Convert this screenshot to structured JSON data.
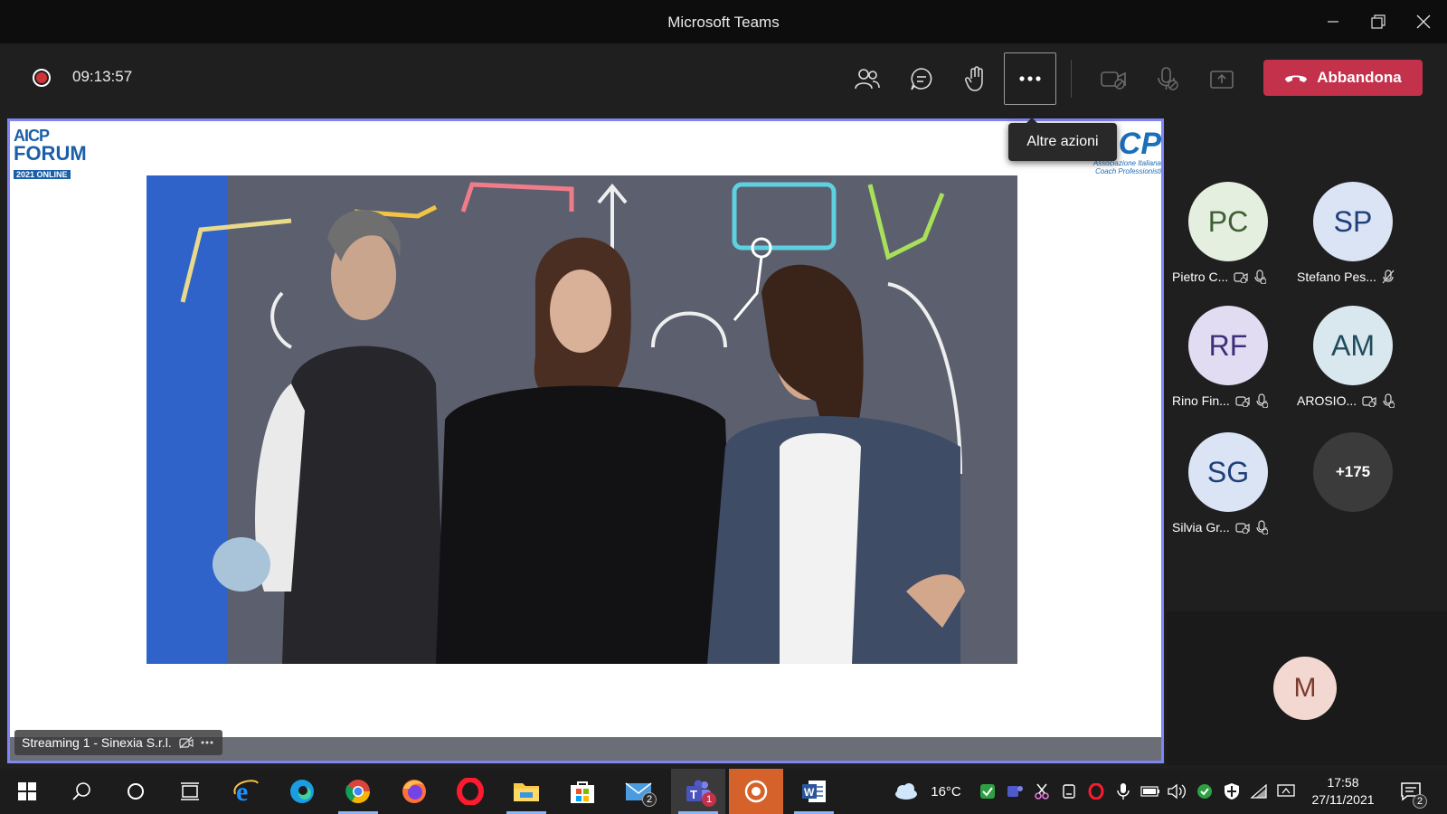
{
  "window": {
    "title": "Microsoft Teams"
  },
  "meeting": {
    "timer": "09:13:57",
    "leave_label": "Abbandona",
    "tooltip": "Altre azioni",
    "shared_label": "Streaming 1 - Sinexia S.r.l.",
    "accent": "#7f85f5",
    "leave_color": "#c4314b"
  },
  "stage": {
    "logo_left": {
      "line1": "AICP",
      "line2": "FORUM",
      "line3": "2021 ONLINE"
    },
    "logo_right": {
      "mark": "CP",
      "sub1": "Associazione Italiana",
      "sub2": "Coach Professionisti"
    }
  },
  "participants": [
    {
      "initials": "PC",
      "name": "Pietro C...",
      "bg": "#e5efe0",
      "fg": "#3e5f34"
    },
    {
      "initials": "SP",
      "name": "Stefano Pes...",
      "bg": "#dbe4f5",
      "fg": "#1f3f7a"
    },
    {
      "initials": "RF",
      "name": "Rino Fin...",
      "bg": "#e2dcf3",
      "fg": "#3c2f78"
    },
    {
      "initials": "AM",
      "name": "AROSIO...",
      "bg": "#d9e8ee",
      "fg": "#1f4c5c"
    },
    {
      "initials": "SG",
      "name": "Silvia Gr...",
      "bg": "#dbe4f5",
      "fg": "#1f3f7a"
    }
  ],
  "overflow_count": "+175",
  "self": {
    "initials": "M"
  },
  "taskbar": {
    "mail_badge": "2",
    "teams_badge": "1",
    "weather": "16°C",
    "time": "17:58",
    "date": "27/11/2021",
    "notifications": "2"
  }
}
